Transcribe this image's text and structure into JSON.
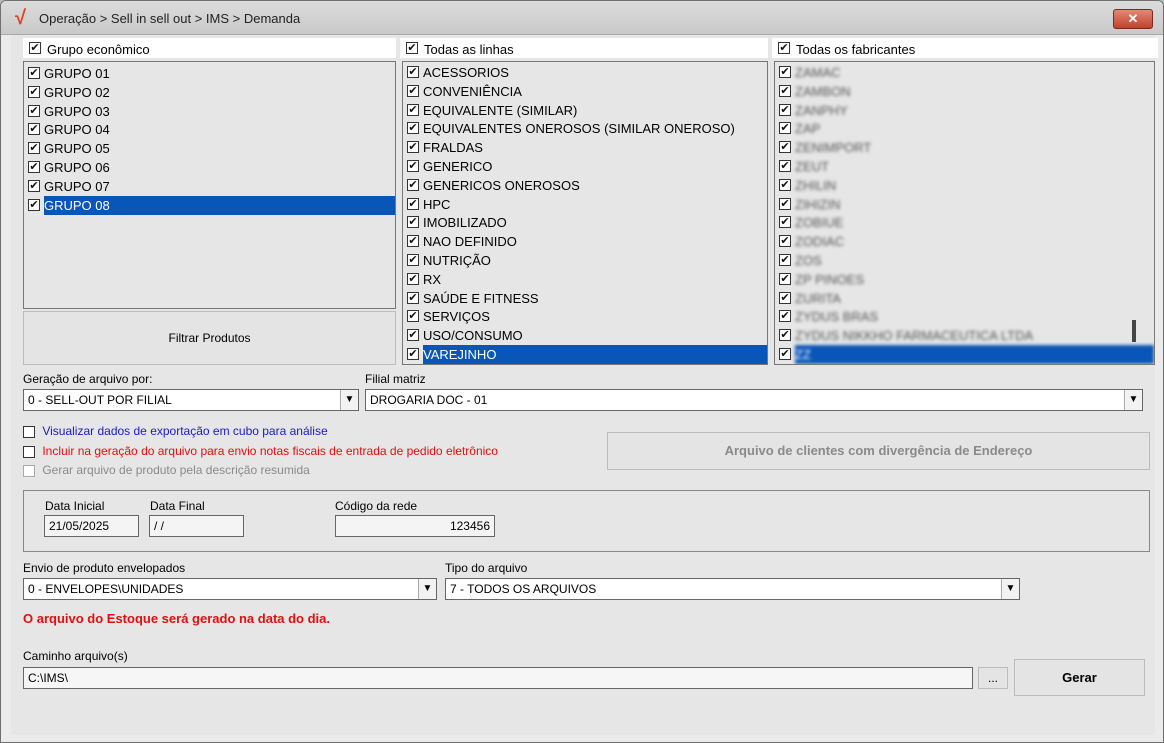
{
  "window": {
    "title": "Operação > Sell in sell out > IMS > Demanda",
    "logo_glyph": "√",
    "close_glyph": "✕"
  },
  "grupo": {
    "header": "Grupo econômico",
    "items": [
      "GRUPO 01",
      "GRUPO 02",
      "GRUPO 03",
      "GRUPO 04",
      "GRUPO 05",
      "GRUPO 06",
      "GRUPO 07",
      "GRUPO 08"
    ],
    "selected_index": 7
  },
  "linhas": {
    "header": "Todas as linhas",
    "items": [
      "ACESSORIOS",
      "CONVENIÊNCIA",
      "EQUIVALENTE (SIMILAR)",
      "EQUIVALENTES ONEROSOS (SIMILAR ONEROSO)",
      "FRALDAS",
      "GENERICO",
      "GENERICOS ONEROSOS",
      "HPC",
      "IMOBILIZADO",
      "NAO DEFINIDO",
      "NUTRIÇÃO",
      "RX",
      "SAÚDE E FITNESS",
      "SERVIÇOS",
      "USO/CONSUMO",
      "VAREJINHO"
    ],
    "selected_index": 15
  },
  "fabricantes": {
    "header": "Todas os fabricantes",
    "items": [
      "ZAMAC",
      "ZAMBON",
      "ZANPHY",
      "ZAP",
      "ZENIMPORT",
      "ZEUT",
      "ZHILIN",
      "ZIHIZIN",
      "ZOBIUE",
      "ZODIAC",
      "ZOS",
      "ZP PINOES",
      "ZURITA",
      "ZYDUS BRAS",
      "ZYDUS NIKKHO FARMACEUTICA LTDA",
      "ZZ"
    ],
    "selected_index": 15
  },
  "filtrar_produtos_label": "Filtrar Produtos",
  "geracao": {
    "label": "Geração de arquivo por:",
    "value": "0 - SELL-OUT POR FILIAL"
  },
  "filial": {
    "label": "Filial matriz",
    "value": "DROGARIA DOC - 01"
  },
  "options": {
    "visualizar": {
      "label": "Visualizar dados de exportação em cubo para análise",
      "color": "#1a1ac8"
    },
    "incluir": {
      "label": "Incluir na geração do arquivo para envio notas fiscais de entrada de pedido eletrônico",
      "color": "#e01010"
    },
    "gerar": {
      "label": "Gerar arquivo de produto pela descrição resumida",
      "color": "#8a8a8a"
    }
  },
  "divergencia_button_label": "Arquivo de clientes com divergência de Endereço",
  "datas": {
    "inicial_label": "Data Inicial",
    "inicial_value": "21/05/2025",
    "final_label": "Data Final",
    "final_value": " / /",
    "codigo_label": "Código da rede",
    "codigo_value": "123456"
  },
  "envio": {
    "label": "Envio de produto envelopados",
    "value": "0 - ENVELOPES\\UNIDADES"
  },
  "tipo": {
    "label": "Tipo do arquivo",
    "value": "7 - TODOS OS ARQUIVOS"
  },
  "warning": {
    "text": "O arquivo do Estoque será gerado na data do dia.",
    "color": "#e01010"
  },
  "caminho": {
    "label": "Caminho arquivo(s)",
    "value": "C:\\IMS\\",
    "browse_label": "..."
  },
  "gerar_button_label": "Gerar"
}
